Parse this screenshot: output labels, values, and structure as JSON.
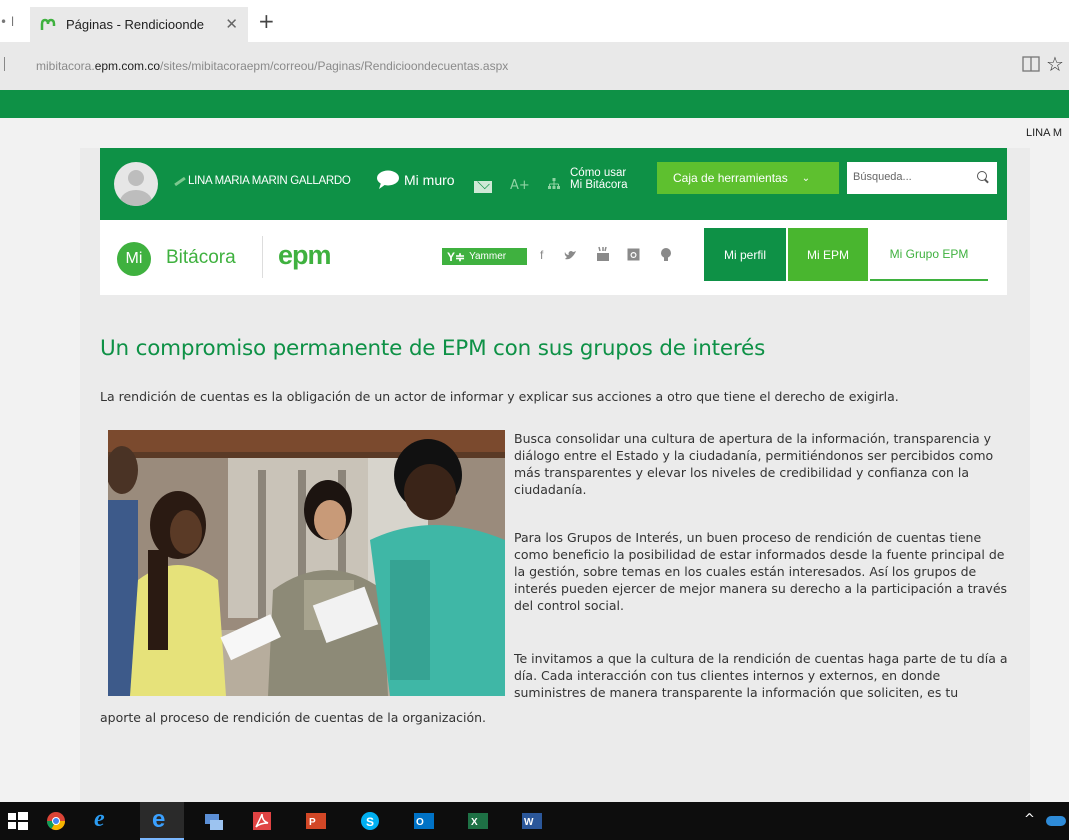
{
  "browser": {
    "tab_title": "Páginas - Rendicioonde",
    "prev_tab_hint": "• l",
    "url_prefix": "mibitacora.",
    "url_domain": "epm.com.co",
    "url_path": "/sites/mibitacoraepm/correou/Paginas/Rendicioondecuentas.aspx",
    "suite_user": "LINA M"
  },
  "nav": {
    "user_name": "LINA MARIA MARIN GALLARDO",
    "my_wall": "Mi muro",
    "font_size": "A+",
    "how_to_line1": "Cómo usar",
    "how_to_line2": "Mi Bitácora",
    "tools": "Caja de herramientas",
    "search_placeholder": "Búsqueda..."
  },
  "brand": {
    "mi": "Mi",
    "site_name": "Bitácora",
    "company": "epm",
    "yammer": "Yammer",
    "tabs": [
      "Mi perfil",
      "Mi EPM",
      "Mi Grupo EPM"
    ]
  },
  "article": {
    "title": "Un compromiso permanente de EPM con sus grupos de interés",
    "intro": "La rendición de cuentas es la obligación de un actor de informar y explicar sus acciones a otro que tiene el derecho de exigirla.",
    "p1": "Busca consolidar una cultura de apertura de la información, transparencia y diálogo entre el Estado y la ciudadanía, permitiéndonos ser percibidos como más transparentes y elevar los niveles de credibilidad y confianza con la ciudadanía.",
    "p2": "Para los Grupos de Interés, un buen proceso de rendición de cuentas tiene como beneficio la posibilidad de estar informados desde la fuente principal de la gestión, sobre temas en los cuales están interesados. Así los grupos de interés pueden ejercer de mejor manera su derecho a la participación a través del control social.",
    "p3": "Te invitamos a que la cultura de la rendición de cuentas haga parte de tu día a día. Cada interacción con tus clientes internos y externos, en donde suministres de manera transparente la información que soliciten, es tu",
    "p3_tail": "aporte al proceso de rendición de cuentas de la organización."
  },
  "colors": {
    "brand_dark_green": "#0e9146",
    "brand_light_green": "#3fb13f",
    "tools_green": "#5ec02f"
  }
}
